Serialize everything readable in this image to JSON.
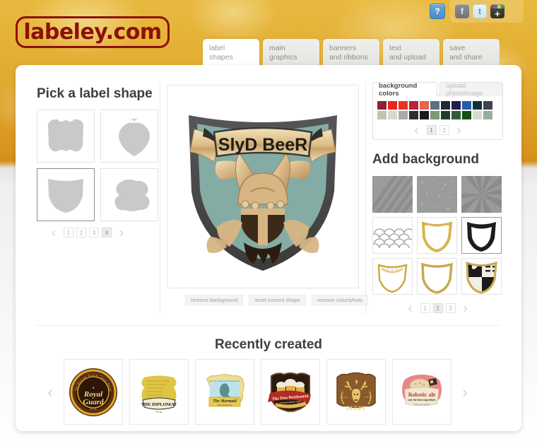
{
  "brand": {
    "logo_text": "labeley.com",
    "logo_color": "#8c1007"
  },
  "topbar": {
    "help_label": "?",
    "social": [
      {
        "name": "facebook-icon",
        "label": "f"
      },
      {
        "name": "twitter-icon",
        "label": "t"
      },
      {
        "name": "googleplus-icon",
        "label": "+"
      }
    ]
  },
  "tabs": [
    {
      "id": "label-shapes",
      "line1": "label",
      "line2": "shapes",
      "active": true
    },
    {
      "id": "main-graphics",
      "line1": "main",
      "line2": "graphics",
      "active": false
    },
    {
      "id": "banners",
      "line1": "banners",
      "line2": "and ribbons",
      "active": false
    },
    {
      "id": "text-upload",
      "line1": "text",
      "line2": "and upload",
      "active": false
    },
    {
      "id": "save-share",
      "line1": "save",
      "line2": "and share",
      "active": false
    }
  ],
  "shapes_panel": {
    "title": "Pick a label shape",
    "items": [
      {
        "id": "shape-1",
        "selected": false
      },
      {
        "id": "shape-2",
        "selected": false
      },
      {
        "id": "shape-3",
        "selected": true
      },
      {
        "id": "shape-4",
        "selected": false
      }
    ],
    "pager": {
      "prev": "‹",
      "next": "›",
      "pages": [
        "1",
        "2",
        "3",
        "4"
      ],
      "current": "4"
    }
  },
  "canvas": {
    "label_title": "SlyD BeeR",
    "shield_border_color": "#4a4a48",
    "shield_fill_color": "#85aca4",
    "banner_color": "#e0c693",
    "graphic_color": "#d8b684",
    "actions": [
      {
        "id": "remove-background",
        "label": "remove background"
      },
      {
        "id": "reset-current-shape",
        "label": "reset current shape"
      },
      {
        "id": "remove-color-photo",
        "label": "remove color/photo"
      }
    ]
  },
  "background_panel": {
    "tabs": [
      {
        "id": "background-colors",
        "label": "background colors",
        "active": true
      },
      {
        "id": "upload-photo",
        "label": "upload photo/image",
        "active": false
      }
    ],
    "colors_row1": [
      "#8e2030",
      "#e8261c",
      "#ec3321",
      "#b52536",
      "#e8644a",
      "#587186",
      "#1e2b33",
      "#231b4f",
      "#1f5fb0",
      "#10303f",
      "#43414f"
    ],
    "colors_row2": [
      "#c3c2b5",
      "#d8d8d2",
      "#a9aaa3",
      "#2d2f2c",
      "#1b1b1b",
      "#7d9a71",
      "#1d3e2f",
      "#2f5c34",
      "#14520f",
      "#d2ddd0",
      "#96ada0"
    ],
    "colors_pager": {
      "prev": "‹",
      "next": "›",
      "pages": [
        "1",
        "2"
      ],
      "current": "1"
    },
    "add_title": "Add background",
    "thumbs": [
      {
        "id": "bg-diagonal-stripes",
        "kind": "stripes",
        "selected": false
      },
      {
        "id": "bg-speckle-texture",
        "kind": "speckle",
        "selected": false
      },
      {
        "id": "bg-sunburst",
        "kind": "sunburst",
        "selected": false
      },
      {
        "id": "bg-scales",
        "kind": "scales",
        "selected": false
      },
      {
        "id": "bg-gold-shield-open",
        "kind": "goldshield",
        "selected": false
      },
      {
        "id": "bg-black-shield",
        "kind": "blackshield",
        "selected": true
      },
      {
        "id": "bg-gold-shield-thin",
        "kind": "goldthin",
        "selected": false
      },
      {
        "id": "bg-gold-shield-wide",
        "kind": "goldwide",
        "selected": false
      },
      {
        "id": "bg-heraldic-crest",
        "kind": "heraldic",
        "selected": false
      }
    ],
    "thumbs_pager": {
      "prev": "‹",
      "next": "›",
      "pages": [
        "1",
        "2",
        "3"
      ],
      "current": "2"
    }
  },
  "recent": {
    "title": "Recently created",
    "prev": "‹",
    "next": "›",
    "items": [
      {
        "id": "recent-royal-guard",
        "kind": "royalguard",
        "top_text": "The Honorary Review Classic Award",
        "line1": "a",
        "line2": "Royal",
        "line3": "Guard",
        "sub": "5% alc"
      },
      {
        "id": "recent-the-diplomat",
        "kind": "diplomat",
        "line1": "THE DIPLOMAT",
        "sub": "5% alc"
      },
      {
        "id": "recent-the-mermaid",
        "kind": "mermaid",
        "top_text": "The Old Captain's Recommendation",
        "line1": "The Mermaid",
        "sub": "light smooth ale"
      },
      {
        "id": "recent-don-bottlement",
        "kind": "don",
        "line1": "The Don Bottlement",
        "sub": "Premium Black Lager",
        "foot": "alc 5%"
      },
      {
        "id": "recent-deery",
        "kind": "deery",
        "line1": "DEERY",
        "left_text": "premium",
        "right_text": "4.5% alc"
      },
      {
        "id": "recent-robotic-ale",
        "kind": "robotic",
        "line1": "Robotic ale",
        "sub": "only the finest ingredients",
        "foot": "4.5% pure alcohol"
      }
    ]
  }
}
